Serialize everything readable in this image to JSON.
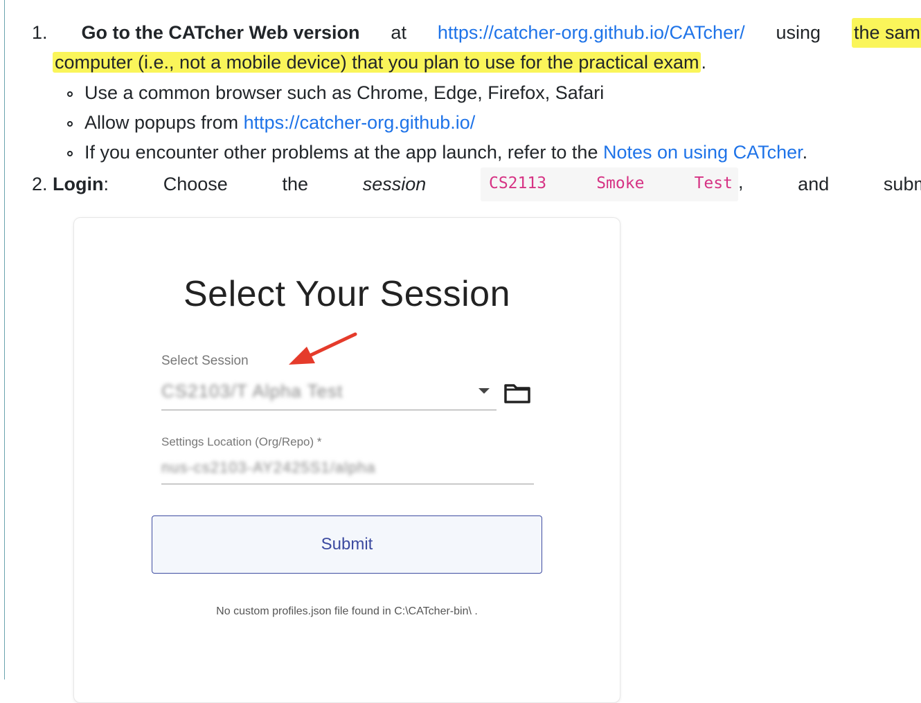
{
  "step1": {
    "number": "1.",
    "bold": "Go to the CATcher Web version",
    "at": "at",
    "url": "https://catcher-org.github.io/CATcher/",
    "using": "using",
    "highlight_part1": "the sam",
    "highlight_part2": "computer (i.e., not a mobile device) that you plan to use for the practical exam",
    "period": ".",
    "subitems": {
      "browser": "Use a common browser such as Chrome, Edge, Firefox, Safari",
      "popups_prefix": "Allow popups from ",
      "popups_url": "https://catcher-org.github.io/",
      "problems_prefix": "If you encounter other problems at the app launch, refer to the ",
      "problems_link": "Notes on using CATcher",
      "problems_suffix": "."
    }
  },
  "step2": {
    "number": "2.",
    "bold": "Login",
    "colon": ":",
    "words": [
      "Choose",
      "the"
    ],
    "session_word": "session",
    "code_words": [
      "CS2113",
      "Smoke",
      "Test"
    ],
    "comma": ",",
    "and": "and",
    "submit_word": "submi"
  },
  "screenshot": {
    "title": "Select Your Session",
    "select_label": "Select Session",
    "select_value_blurred": "CS2103/T Alpha Test",
    "settings_label": "Settings Location (Org/Repo) *",
    "settings_value_blurred": "nus-cs2103-AY2425S1/alpha",
    "submit_label": "Submit",
    "note": "No custom profiles.json file found in C:\\CATcher-bin\\ .",
    "arrow_color": "#e53b2b"
  }
}
